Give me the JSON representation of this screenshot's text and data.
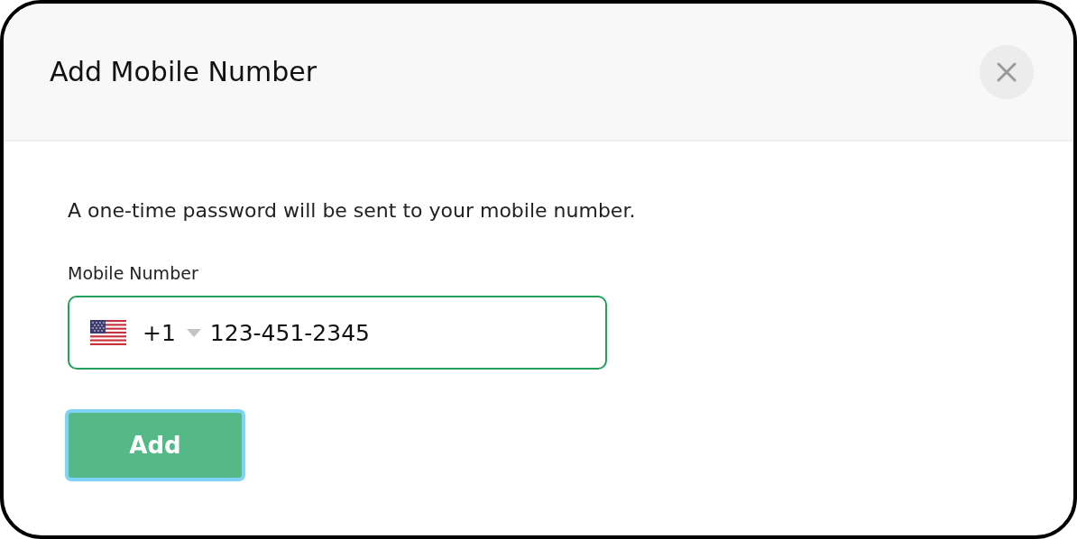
{
  "dialog": {
    "title": "Add Mobile Number"
  },
  "message": "A one-time password will be sent to your mobile number.",
  "field": {
    "label": "Mobile Number",
    "country_code": "+1",
    "value": "123-451-2345"
  },
  "button": {
    "label": "Add",
    "focused": true
  }
}
